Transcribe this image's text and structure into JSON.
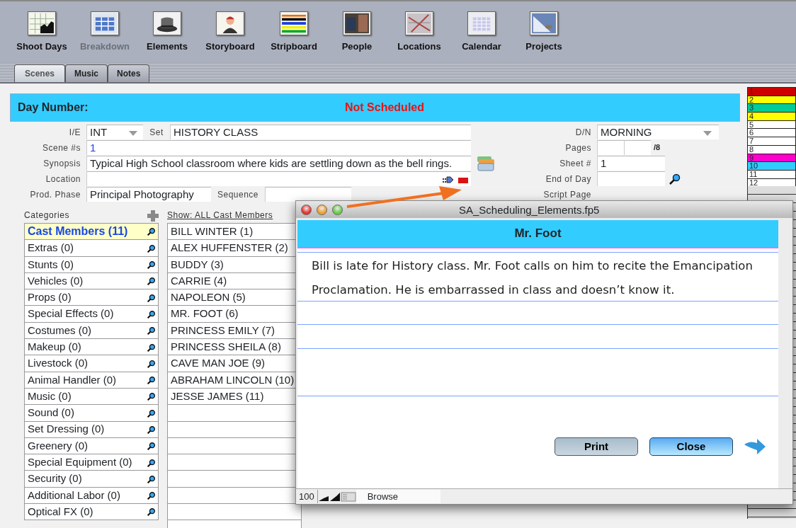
{
  "toolbar": {
    "items": [
      {
        "label": "Shoot Days",
        "disabled": false,
        "kind": "calendar-grid"
      },
      {
        "label": "Breakdown",
        "disabled": true,
        "kind": "sheet"
      },
      {
        "label": "Elements",
        "disabled": false,
        "kind": "hat"
      },
      {
        "label": "Storyboard",
        "disabled": false,
        "kind": "figure"
      },
      {
        "label": "Stripboard",
        "disabled": false,
        "kind": "stripes"
      },
      {
        "label": "People",
        "disabled": false,
        "kind": "photo"
      },
      {
        "label": "Locations",
        "disabled": false,
        "kind": "map"
      },
      {
        "label": "Calendar",
        "disabled": false,
        "kind": "calendar"
      },
      {
        "label": "Projects",
        "disabled": false,
        "kind": "folder"
      }
    ]
  },
  "tabs": [
    {
      "label": "Scenes",
      "selected": true
    },
    {
      "label": "Music",
      "selected": false
    },
    {
      "label": "Notes",
      "selected": false
    }
  ],
  "day_bar": {
    "label": "Day Number:",
    "status": "Not Scheduled"
  },
  "scene_form": {
    "ie": {
      "label": "I/E",
      "value": "INT"
    },
    "set": {
      "label": "Set",
      "value": "HISTORY CLASS"
    },
    "scene_numbers": {
      "label": "Scene #s",
      "value": "1"
    },
    "synopsis": {
      "label": "Synopsis",
      "value": "Typical High School classroom where kids are settling down as the bell rings."
    },
    "location": {
      "label": "Location"
    },
    "prod_phase": {
      "label": "Prod. Phase",
      "value": "Principal Photography"
    },
    "sequence": {
      "label": "Sequence"
    },
    "dn": {
      "label": "D/N",
      "value": "MORNING"
    },
    "pages": {
      "label": "Pages",
      "suffix": "/8"
    },
    "sheet": {
      "label": "Sheet #",
      "value": "1"
    },
    "end_of_day": {
      "label": "End of Day"
    },
    "script_page": {
      "label": "Script Page"
    }
  },
  "categories": {
    "header": "Categories",
    "items": [
      {
        "label": "Cast Members (11)",
        "selected": true
      },
      {
        "label": "Extras (0)",
        "selected": false
      },
      {
        "label": "Stunts (0)",
        "selected": false
      },
      {
        "label": "Vehicles (0)",
        "selected": false
      },
      {
        "label": "Props (0)",
        "selected": false
      },
      {
        "label": "Special Effects (0)",
        "selected": false
      },
      {
        "label": "Costumes (0)",
        "selected": false
      },
      {
        "label": "Makeup (0)",
        "selected": false
      },
      {
        "label": "Livestock (0)",
        "selected": false
      },
      {
        "label": "Animal Handler (0)",
        "selected": false
      },
      {
        "label": "Music (0)",
        "selected": false
      },
      {
        "label": "Sound (0)",
        "selected": false
      },
      {
        "label": "Set Dressing (0)",
        "selected": false
      },
      {
        "label": "Greenery (0)",
        "selected": false
      },
      {
        "label": "Special Equipment (0)",
        "selected": false
      },
      {
        "label": "Security (0)",
        "selected": false
      },
      {
        "label": "Additional Labor (0)",
        "selected": false
      },
      {
        "label": "Optical FX (0)",
        "selected": false
      }
    ]
  },
  "cast": {
    "show_link": "Show: ALL Cast Members",
    "members": [
      "BILL WINTER (1)",
      "ALEX HUFFENSTER (2)",
      "BUDDY (3)",
      "CARRIE (4)",
      "NAPOLEON (5)",
      "MR. FOOT (6)",
      "PRINCESS EMILY (7)",
      "PRINCESS SHEILA (8)",
      "CAVE MAN JOE (9)",
      "ABRAHAM LINCOLN (10)",
      "JESSE JAMES (11)"
    ]
  },
  "strip": [
    {
      "number": "1",
      "color": "#cc0000"
    },
    {
      "number": "2",
      "color": "#ffff00"
    },
    {
      "number": "3",
      "color": "#00cc99"
    },
    {
      "number": "4",
      "color": "#ffff00"
    },
    {
      "number": "5",
      "color": "#ffffff"
    },
    {
      "number": "6",
      "color": "#ffffff"
    },
    {
      "number": "7",
      "color": "#ffffff"
    },
    {
      "number": "8",
      "color": "#ffffff"
    },
    {
      "number": "9",
      "color": "#ff00cc"
    },
    {
      "number": "10",
      "color": "#33ccff"
    },
    {
      "number": "11",
      "color": "#ffffff"
    },
    {
      "number": "12",
      "color": "#ffffff"
    }
  ],
  "dialog": {
    "title": "SA_Scheduling_Elements.fp5",
    "heading": "Mr. Foot",
    "note": "Bill is late for History class. Mr. Foot calls on him to recite the Emancipation Proclamation. He is embarrassed in class and doesn’t know it.",
    "buttons": [
      {
        "label": "Print",
        "default": false
      },
      {
        "label": "Close",
        "default": true
      }
    ],
    "status": {
      "zoom": "100",
      "mode": "Browse"
    }
  }
}
